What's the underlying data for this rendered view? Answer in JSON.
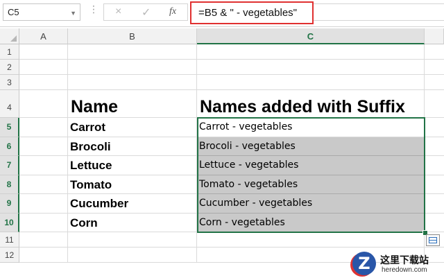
{
  "formula_bar": {
    "name_box": "C5",
    "cancel_icon": "×",
    "enter_icon": "✓",
    "fx_label": "fx",
    "formula": "=B5 & \" - vegetables\""
  },
  "columns": [
    {
      "label": "A",
      "selected": false
    },
    {
      "label": "B",
      "selected": false
    },
    {
      "label": "C",
      "selected": true
    }
  ],
  "rows": [
    {
      "num": "1",
      "b": "",
      "c": "",
      "type": "empty",
      "selected": false
    },
    {
      "num": "2",
      "b": "",
      "c": "",
      "type": "empty",
      "selected": false
    },
    {
      "num": "3",
      "b": "",
      "c": "",
      "type": "empty",
      "selected": false
    },
    {
      "num": "4",
      "b": "Name",
      "c": "Names added with Suffix",
      "type": "header",
      "selected": false
    },
    {
      "num": "5",
      "b": "Carrot",
      "c": "Carrot - vegetables",
      "type": "data",
      "shaded": false,
      "selected": true
    },
    {
      "num": "6",
      "b": "Brocoli",
      "c": "Brocoli - vegetables",
      "type": "data",
      "shaded": true,
      "selected": true
    },
    {
      "num": "7",
      "b": "Lettuce",
      "c": "Lettuce - vegetables",
      "type": "data",
      "shaded": true,
      "selected": true
    },
    {
      "num": "8",
      "b": "Tomato",
      "c": "Tomato - vegetables",
      "type": "data",
      "shaded": true,
      "selected": true
    },
    {
      "num": "9",
      "b": "Cucumber",
      "c": "Cucumber - vegetables",
      "type": "data",
      "shaded": true,
      "selected": true
    },
    {
      "num": "10",
      "b": "Corn",
      "c": "Corn - vegetables",
      "type": "data",
      "shaded": true,
      "selected": true
    },
    {
      "num": "11",
      "b": "",
      "c": "",
      "type": "empty",
      "selected": false
    },
    {
      "num": "12",
      "b": "",
      "c": "",
      "type": "empty",
      "selected": false
    }
  ],
  "colors": {
    "selection": "#217346",
    "shade": "#c9c9c9",
    "highlight_box": "#e03030"
  },
  "watermark": {
    "logo_letter": "Z",
    "cn": "这里下载站",
    "en": "heredown.com"
  }
}
